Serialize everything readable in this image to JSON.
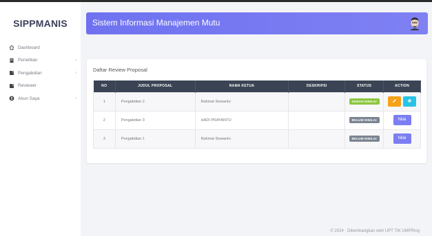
{
  "app": {
    "brand": "SIPPMANIS"
  },
  "sidebar": {
    "items": [
      {
        "label": "Dashboard",
        "icon": "home-icon",
        "has_submenu": false
      },
      {
        "label": "Penelitian",
        "icon": "document-icon",
        "has_submenu": true
      },
      {
        "label": "Pengabdian",
        "icon": "folder-icon",
        "has_submenu": true
      },
      {
        "label": "Reviewer",
        "icon": "folder-icon",
        "has_submenu": false
      },
      {
        "label": "Akun Saya",
        "icon": "user-circle-icon",
        "has_submenu": true
      }
    ]
  },
  "header": {
    "title": "Sistem Informasi Manajemen Mutu"
  },
  "card": {
    "title": "Daftar Review Proposal"
  },
  "table": {
    "columns": [
      "NO",
      "JUDUL PROPOSAL",
      "NAMA KETUA",
      "DESKRIPSI",
      "STATUS",
      "ACTION"
    ],
    "rows": [
      {
        "no": "1",
        "judul": "Pengabdian 2",
        "ketua": "Rahmat Siswanto",
        "deskripsi": "",
        "status": "SUDAH DINILAI",
        "status_color": "#8cc63f",
        "actions": [
          "edit",
          "view"
        ]
      },
      {
        "no": "2",
        "judul": "Pengabdian 3",
        "ketua": "HADI PRAYANTO",
        "deskripsi": "",
        "status": "BELUM DINILAI",
        "status_color": "#7b8491",
        "actions": [
          "nilai"
        ]
      },
      {
        "no": "3",
        "judul": "Pengabdian 1",
        "ketua": "Rahmat Siswanto",
        "deskripsi": "",
        "status": "BELUM DINILAI",
        "status_color": "#7b8491",
        "actions": [
          "nilai"
        ]
      }
    ],
    "nilai_label": "Nilai",
    "edit_icon": "pencil-icon",
    "view_icon": "gear-icon"
  },
  "footer": {
    "text": "© 2024 · Dikembangkan oleh UPT TIK UMPRing"
  },
  "colors": {
    "header": "#7577f1",
    "table_head": "#3a4454",
    "edit": "#f6a118",
    "view": "#29c3e6",
    "nilai": "#7b7ef2"
  }
}
